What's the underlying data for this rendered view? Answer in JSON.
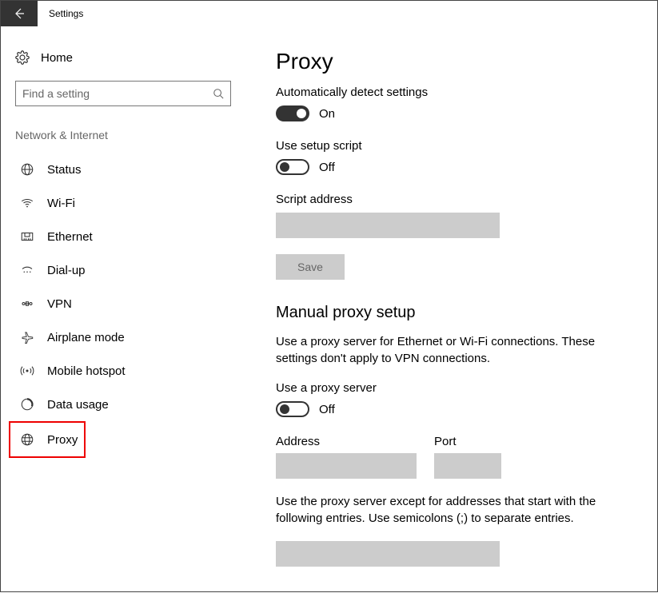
{
  "titlebar": {
    "title": "Settings"
  },
  "sidebar": {
    "home": "Home",
    "search_placeholder": "Find a setting",
    "section": "Network & Internet",
    "items": [
      {
        "label": "Status"
      },
      {
        "label": "Wi-Fi"
      },
      {
        "label": "Ethernet"
      },
      {
        "label": "Dial-up"
      },
      {
        "label": "VPN"
      },
      {
        "label": "Airplane mode"
      },
      {
        "label": "Mobile hotspot"
      },
      {
        "label": "Data usage"
      },
      {
        "label": "Proxy"
      }
    ]
  },
  "main": {
    "heading": "Proxy",
    "auto_detect_label": "Automatically detect settings",
    "auto_detect_state": "On",
    "setup_script_label": "Use setup script",
    "setup_script_state": "Off",
    "script_address_label": "Script address",
    "save_label": "Save",
    "manual_heading": "Manual proxy setup",
    "manual_desc": "Use a proxy server for Ethernet or Wi-Fi connections. These settings don't apply to VPN connections.",
    "use_proxy_label": "Use a proxy server",
    "use_proxy_state": "Off",
    "address_label": "Address",
    "port_label": "Port",
    "exceptions_desc": "Use the proxy server except for addresses that start with the following entries. Use semicolons (;) to separate entries."
  }
}
